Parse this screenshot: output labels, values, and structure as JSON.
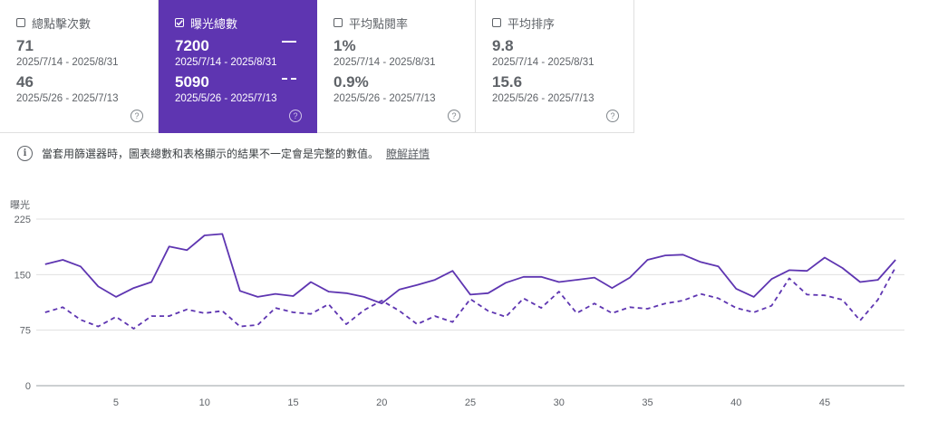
{
  "cards": [
    {
      "label": "總點擊次數",
      "value1": "71",
      "range1": "2025/7/14 - 2025/8/31",
      "value2": "46",
      "range2": "2025/5/26 - 2025/7/13",
      "checked": false
    },
    {
      "label": "曝光總數",
      "value1": "7200",
      "range1": "2025/7/14 - 2025/8/31",
      "value2": "5090",
      "range2": "2025/5/26 - 2025/7/13",
      "checked": true
    },
    {
      "label": "平均點閱率",
      "value1": "1%",
      "range1": "2025/7/14 - 2025/8/31",
      "value2": "0.9%",
      "range2": "2025/5/26 - 2025/7/13",
      "checked": false
    },
    {
      "label": "平均排序",
      "value1": "9.8",
      "range1": "2025/7/14 - 2025/8/31",
      "value2": "15.6",
      "range2": "2025/5/26 - 2025/7/13",
      "checked": false
    }
  ],
  "help_glyph": "?",
  "info": {
    "text": "當套用篩選器時，圖表總數和表格顯示的結果不一定會是完整的數值。",
    "link": "瞭解詳情",
    "icon": "info-icon"
  },
  "colors": {
    "accent": "#5e35b1",
    "line": "#5e35b1",
    "grid": "#e0e0e0"
  },
  "chart_data": {
    "type": "line",
    "ylabel": "曝光",
    "ylim": [
      0,
      225
    ],
    "yticks": [
      0,
      75,
      150,
      225
    ],
    "xticks": [
      5,
      10,
      15,
      20,
      25,
      30,
      35,
      40,
      45
    ],
    "x": [
      1,
      2,
      3,
      4,
      5,
      6,
      7,
      8,
      9,
      10,
      11,
      12,
      13,
      14,
      15,
      16,
      17,
      18,
      19,
      20,
      21,
      22,
      23,
      24,
      25,
      26,
      27,
      28,
      29,
      30,
      31,
      32,
      33,
      34,
      35,
      36,
      37,
      38,
      39,
      40,
      41,
      42,
      43,
      44,
      45,
      46,
      47,
      48,
      49
    ],
    "series": [
      {
        "style": "solid",
        "values": [
          164,
          170,
          161,
          134,
          120,
          132,
          140,
          188,
          183,
          203,
          205,
          128,
          120,
          124,
          121,
          140,
          127,
          125,
          120,
          111,
          130,
          136,
          143,
          155,
          123,
          125,
          139,
          147,
          147,
          140,
          143,
          146,
          132,
          146,
          170,
          176,
          177,
          167,
          161,
          131,
          120,
          144,
          156,
          155,
          173,
          159,
          140,
          143,
          170
        ]
      },
      {
        "style": "dashed",
        "values": [
          99,
          106,
          89,
          80,
          93,
          77,
          94,
          94,
          103,
          98,
          101,
          80,
          82,
          105,
          99,
          97,
          110,
          83,
          102,
          115,
          101,
          83,
          94,
          86,
          117,
          101,
          93,
          118,
          105,
          127,
          98,
          111,
          98,
          106,
          104,
          111,
          115,
          124,
          118,
          105,
          99,
          108,
          145,
          123,
          122,
          116,
          88,
          116,
          160
        ]
      }
    ]
  }
}
